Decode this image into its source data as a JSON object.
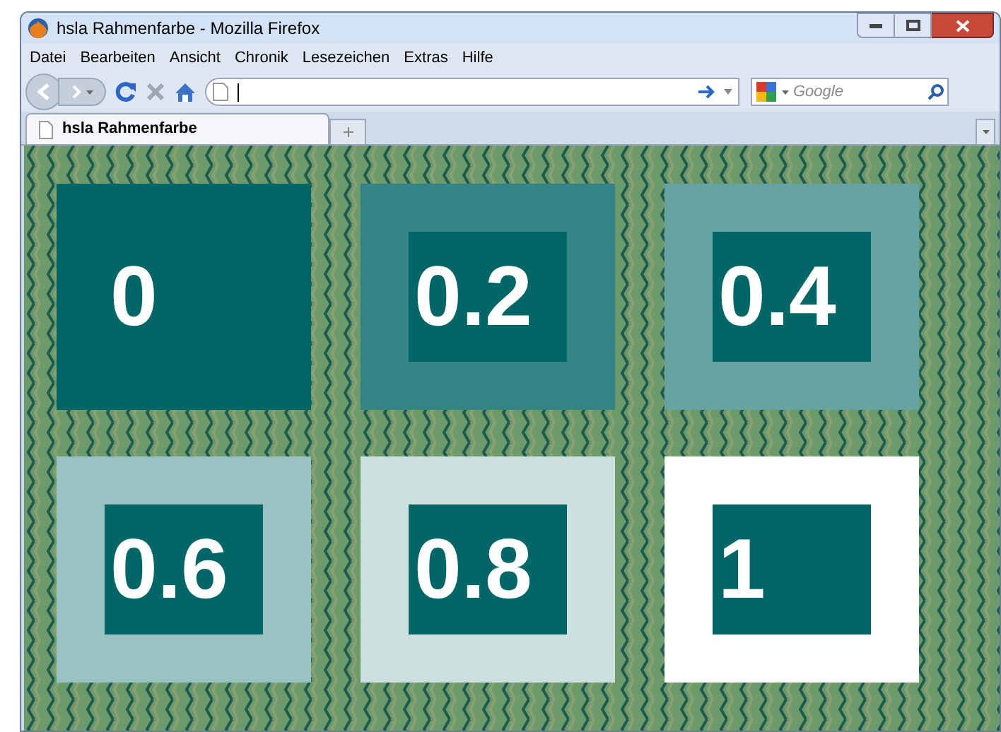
{
  "window": {
    "title": "hsla Rahmenfarbe - Mozilla Firefox"
  },
  "menu": [
    "Datei",
    "Bearbeiten",
    "Ansicht",
    "Chronik",
    "Lesezeichen",
    "Extras",
    "Hilfe"
  ],
  "search": {
    "placeholder": "Google"
  },
  "tabs": [
    {
      "label": "hsla Rahmenfarbe",
      "selected": true
    }
  ],
  "boxes": [
    {
      "label": "0",
      "color": "#006666"
    },
    {
      "label": "0.2",
      "color": "#338585"
    },
    {
      "label": "0.4",
      "color": "#66a3a3"
    },
    {
      "label": "0.6",
      "color": "#99c2c2"
    },
    {
      "label": "0.8",
      "color": "#cce0e0"
    },
    {
      "label": "1",
      "color": "#ffffff"
    }
  ]
}
